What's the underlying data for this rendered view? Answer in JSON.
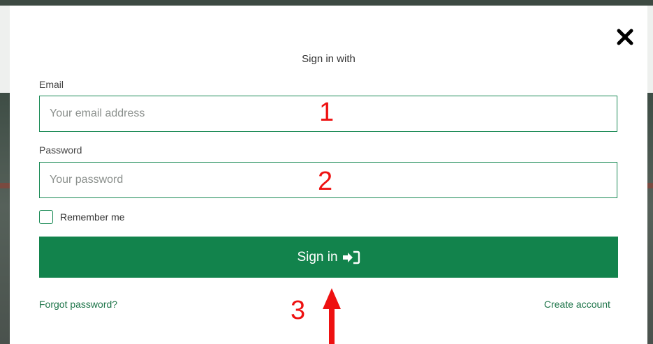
{
  "modal": {
    "title": "Sign in with",
    "email": {
      "label": "Email",
      "placeholder": "Your email address",
      "value": ""
    },
    "password": {
      "label": "Password",
      "placeholder": "Your password",
      "value": ""
    },
    "remember_label": "Remember me",
    "signin_label": "Sign in",
    "forgot_label": "Forgot password?",
    "create_label": "Create account"
  },
  "annotations": {
    "one": "1",
    "two": "2",
    "three": "3"
  },
  "colors": {
    "accent": "#12834c",
    "annotation": "#ee1111",
    "link": "#1b7347"
  },
  "icons": [
    "close-icon",
    "sign-in-icon",
    "up-arrow-annotation"
  ]
}
